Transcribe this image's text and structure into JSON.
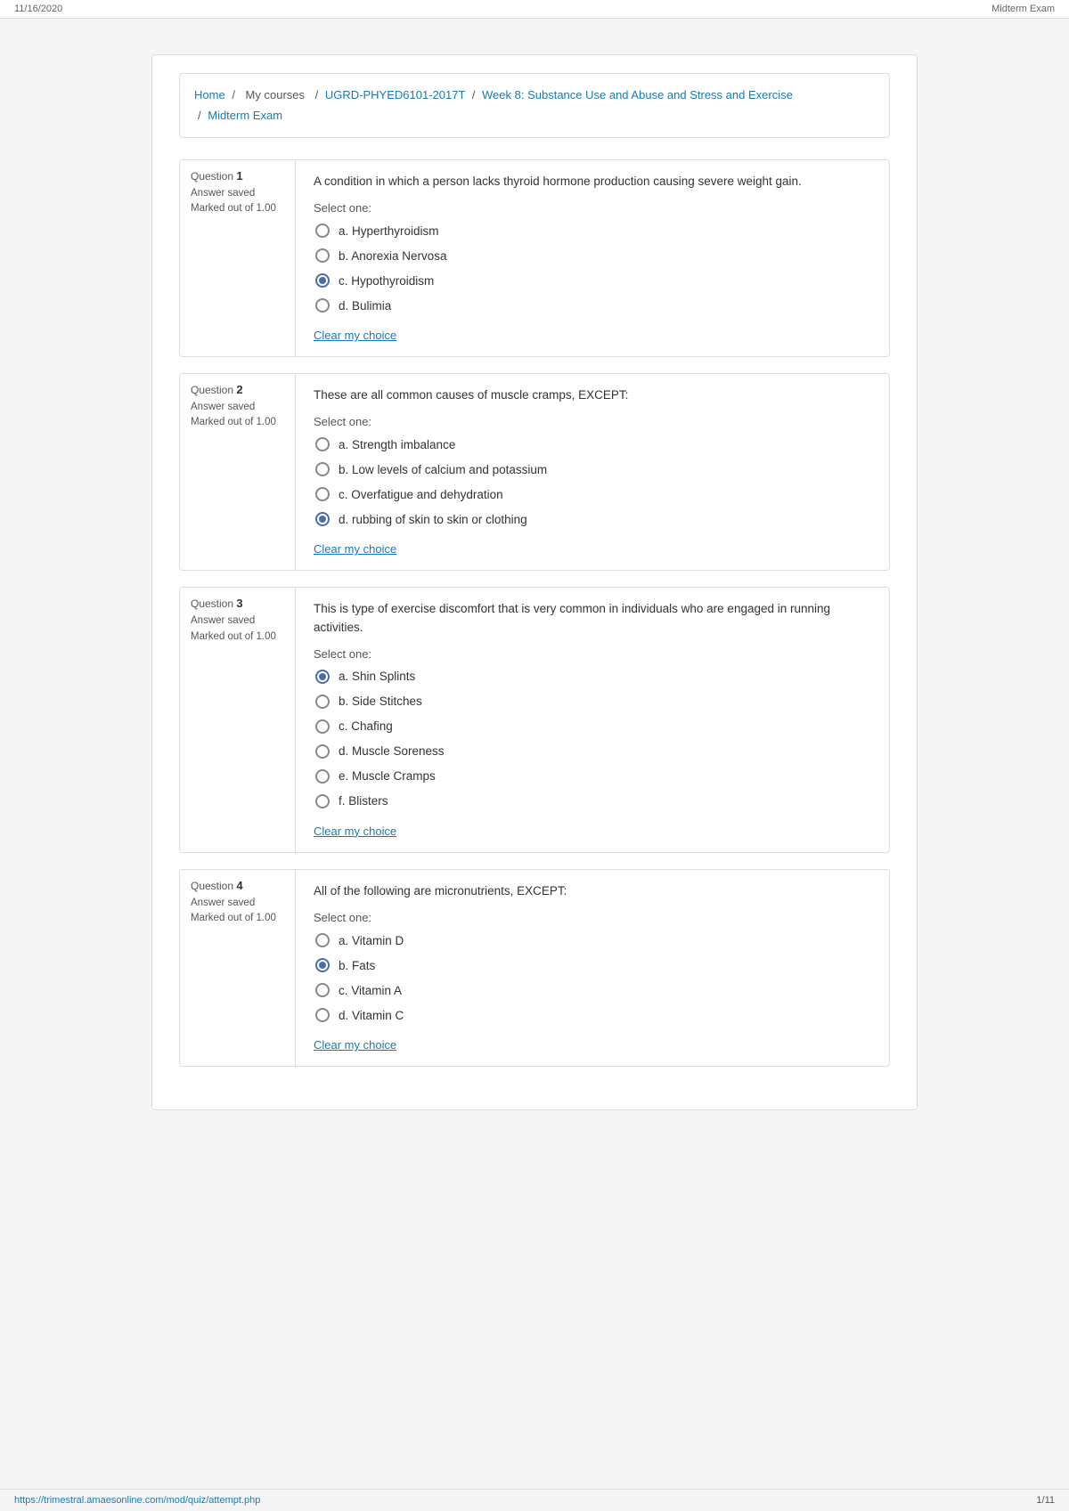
{
  "meta": {
    "date": "11/16/2020",
    "page_title": "Midterm Exam",
    "bottom_url": "https://trimestral.amaesonline.com/mod/quiz/attempt.php",
    "page_count": "1/11"
  },
  "breadcrumb": {
    "items": [
      {
        "label": "Home",
        "href": "#"
      },
      {
        "label": "My courses",
        "href": null
      },
      {
        "label": "UGRD-PHYED6101-2017T",
        "href": "#"
      },
      {
        "label": "Week 8: Substance Use and Abuse and Stress and Exercise",
        "href": "#"
      },
      {
        "label": "Midterm Exam",
        "href": "#"
      }
    ]
  },
  "questions": [
    {
      "number": "1",
      "status": "Answer saved",
      "marked": "Marked out of 1.00",
      "text": "A condition in which a person lacks thyroid hormone production causing severe weight gain.",
      "select_one": "Select one:",
      "options": [
        {
          "label": "a. Hyperthyroidism",
          "selected": false
        },
        {
          "label": "b. Anorexia Nervosa",
          "selected": false
        },
        {
          "label": "c. Hypothyroidism",
          "selected": true
        },
        {
          "label": "d. Bulimia",
          "selected": false
        }
      ],
      "clear_label": "Clear my choice"
    },
    {
      "number": "2",
      "status": "Answer saved",
      "marked": "Marked out of 1.00",
      "text": "These are all common causes of muscle cramps, EXCEPT:",
      "select_one": "Select one:",
      "options": [
        {
          "label": "a. Strength imbalance",
          "selected": false
        },
        {
          "label": "b. Low levels of calcium and potassium",
          "selected": false
        },
        {
          "label": "c. Overfatigue and dehydration",
          "selected": false
        },
        {
          "label": "d. rubbing of skin to skin or clothing",
          "selected": true
        }
      ],
      "clear_label": "Clear my choice"
    },
    {
      "number": "3",
      "status": "Answer saved",
      "marked": "Marked out of 1.00",
      "text": "This is type of exercise discomfort that is very common in individuals who are engaged in running activities.",
      "select_one": "Select one:",
      "options": [
        {
          "label": "a. Shin Splints",
          "selected": true
        },
        {
          "label": "b. Side Stitches",
          "selected": false
        },
        {
          "label": "c. Chafing",
          "selected": false
        },
        {
          "label": "d. Muscle Soreness",
          "selected": false
        },
        {
          "label": "e. Muscle Cramps",
          "selected": false
        },
        {
          "label": "f. Blisters",
          "selected": false
        }
      ],
      "clear_label": "Clear my choice"
    },
    {
      "number": "4",
      "status": "Answer saved",
      "marked": "Marked out of 1.00",
      "text": "All of the following are micronutrients, EXCEPT:",
      "select_one": "Select one:",
      "options": [
        {
          "label": "a. Vitamin D",
          "selected": false
        },
        {
          "label": "b. Fats",
          "selected": true
        },
        {
          "label": "c. Vitamin A",
          "selected": false
        },
        {
          "label": "d. Vitamin C",
          "selected": false
        }
      ],
      "clear_label": "Clear my choice"
    }
  ]
}
